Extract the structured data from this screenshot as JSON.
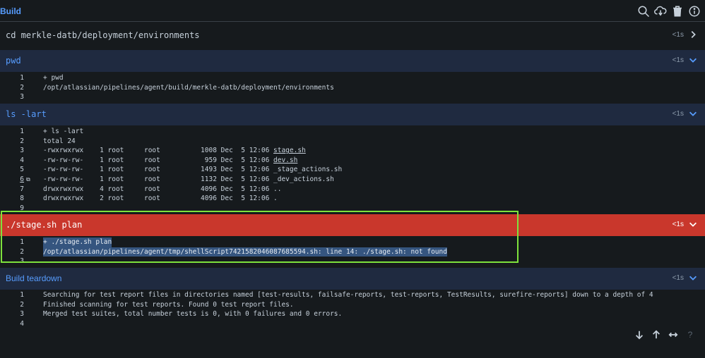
{
  "header": {
    "title": "Build"
  },
  "steps": [
    {
      "command": "cd merkle-datb/deployment/environments",
      "duration": "<1s"
    },
    {
      "command": "pwd",
      "duration": "<1s",
      "lines": [
        {
          "n": "1",
          "t": "+ pwd"
        },
        {
          "n": "2",
          "t": "/opt/atlassian/pipelines/agent/build/merkle-datb/deployment/environments"
        },
        {
          "n": "3",
          "t": ""
        }
      ]
    },
    {
      "command": "ls -lart",
      "duration": "<1s",
      "lines": [
        {
          "n": "1",
          "t": "+ ls -lart"
        },
        {
          "n": "2",
          "t": "total 24"
        },
        {
          "n": "3",
          "t": "-rwxrwxrwx    1 root     root          1008 Dec  5 12:06 ",
          "f": "stage.sh"
        },
        {
          "n": "4",
          "t": "-rw-rw-rw-    1 root     root           959 Dec  5 12:06 ",
          "f": "dev.sh"
        },
        {
          "n": "5",
          "t": "-rw-rw-rw-    1 root     root          1493 Dec  5 12:06 ",
          "f": "_stage_actions.sh"
        },
        {
          "n": "6",
          "t": "-rw-rw-rw-    1 root     root          1132 Dec  5 12:06 ",
          "f": "_dev_actions.sh"
        },
        {
          "n": "7",
          "t": "drwxrwxrwx    4 root     root          4096 Dec  5 12:06 ",
          "f": ".."
        },
        {
          "n": "8",
          "t": "drwxrwxrwx    2 root     root          4096 Dec  5 12:06 ",
          "f": "."
        },
        {
          "n": "9",
          "t": ""
        }
      ]
    },
    {
      "command": "./stage.sh plan",
      "duration": "<1s",
      "lines": [
        {
          "n": "1",
          "t": "+ ./stage.sh plan"
        },
        {
          "n": "2",
          "t": "/opt/atlassian/pipelines/agent/tmp/shellScript7421582046087685594.sh: line 14: ./stage.sh: not found"
        },
        {
          "n": "3",
          "t": ""
        }
      ]
    },
    {
      "command": "Build teardown",
      "duration": "<1s",
      "lines": [
        {
          "n": "1",
          "t": "Searching for test report files in directories named [test-results, failsafe-reports, test-reports, TestResults, surefire-reports] down to a depth of 4"
        },
        {
          "n": "2",
          "t": "Finished scanning for test reports. Found 0 test report files."
        },
        {
          "n": "3",
          "t": "Merged test suites, total number tests is 0, with 0 failures and 0 errors."
        },
        {
          "n": "4",
          "t": ""
        }
      ]
    }
  ],
  "footer": {
    "help_label": "?"
  },
  "colors": {
    "accent": "#579dff",
    "error_bg": "#c9372c",
    "header_bg": "#1f2a40",
    "highlight_border": "#7ee23c"
  }
}
